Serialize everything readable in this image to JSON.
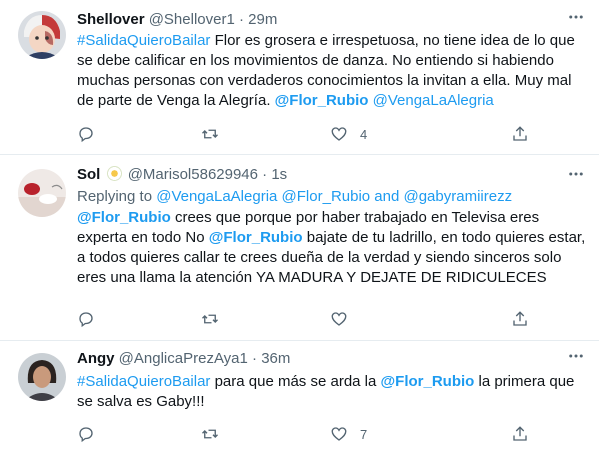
{
  "tweets": [
    {
      "name": "Shellover",
      "handle": "@Shellover1",
      "dot": "·",
      "time": "29m",
      "body_segments": [
        {
          "type": "link",
          "text": "#SalidaQuieroBailar"
        },
        {
          "type": "text",
          "text": " Flor es grosera e irrespetuosa, no tiene idea de  lo que se debe calificar en los movimientos de danza. No entiendo si habiendo muchas personas con verdaderos conocimientos la invitan a ella.  Muy mal de parte de Venga la Alegría. "
        },
        {
          "type": "mention",
          "text": "@Flor_Rubio"
        },
        {
          "type": "text",
          "text": " "
        },
        {
          "type": "link",
          "text": "@VengaLaAlegria"
        }
      ],
      "counts": {
        "reply": "",
        "retweet": "",
        "like": "4"
      }
    },
    {
      "name": "Sol",
      "emoji": "flower-emoji",
      "handle": "@Marisol58629946",
      "dot": "·",
      "time": "1s",
      "replying_prefix": "Replying to ",
      "replying_to": "@VengaLaAlegria @Flor_Rubio and @gabyramiirezz",
      "body_segments": [
        {
          "type": "mention",
          "text": "@Flor_Rubio"
        },
        {
          "type": "text",
          "text": " crees que porque por haber trabajado en Televisa eres experta en todo No "
        },
        {
          "type": "mention",
          "text": "@Flor_Rubio"
        },
        {
          "type": "text",
          "text": " bajate de tu ladrillo, en todo quieres estar, a todos quieres callar te crees dueña de la verdad y siendo sinceros solo eres una llama la atención YA MADURA Y DEJATE DE RIDICULECES"
        }
      ],
      "counts": {
        "reply": "",
        "retweet": "",
        "like": ""
      }
    },
    {
      "name": "Angy",
      "handle": "@AnglicaPrezAya1",
      "dot": "·",
      "time": "36m",
      "body_segments": [
        {
          "type": "link",
          "text": "#SalidaQuieroBailar"
        },
        {
          "type": "text",
          "text": " para que más se arda la "
        },
        {
          "type": "mention",
          "text": "@Flor_Rubio"
        },
        {
          "type": "text",
          "text": " la primera que se salva es Gaby!!!"
        }
      ],
      "counts": {
        "reply": "",
        "retweet": "",
        "like": "7"
      }
    }
  ],
  "icons": {
    "more": "more-horizontal-icon",
    "reply": "reply-icon",
    "retweet": "retweet-icon",
    "like": "heart-icon",
    "share": "share-icon"
  },
  "colors": {
    "link": "#1d9bf0",
    "muted": "#536471",
    "text": "#0f1419",
    "divider": "#e6ecf0"
  }
}
